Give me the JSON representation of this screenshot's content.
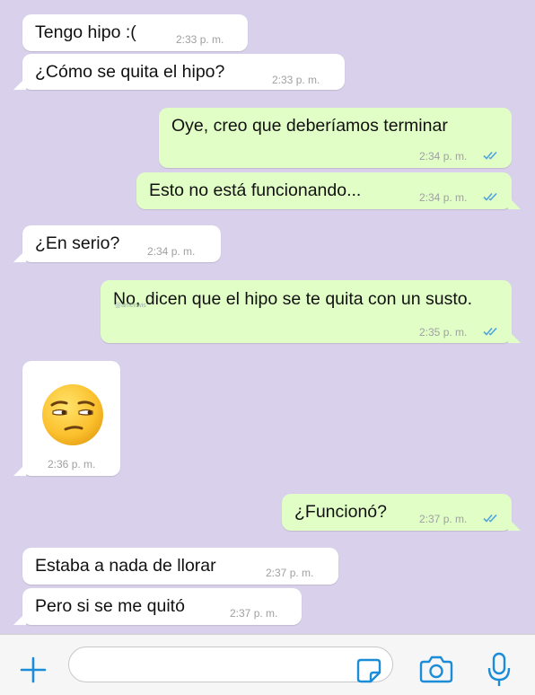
{
  "messages": [
    {
      "text": "Tengo hipo :(",
      "time": "2:33 p. m."
    },
    {
      "text": "¿Cómo se quita el hipo?",
      "time": "2:33 p. m."
    },
    {
      "text": "Oye, creo que deberíamos terminar",
      "time": "2:34 p. m."
    },
    {
      "text": "Esto no está funcionando...",
      "time": "2:34 p. m."
    },
    {
      "text": "¿En serio?",
      "time": "2:34 p. m."
    },
    {
      "text": "No, dicen que el hipo se te quita con un susto.",
      "time": "2:35 p. m.",
      "watermark": "@amenwis"
    },
    {
      "emoji": "😒",
      "time": "2:36 p. m."
    },
    {
      "text": "¿Funcionó?",
      "time": "2:37 p. m."
    },
    {
      "text": "Estaba a nada de llorar",
      "time": "2:37 p. m."
    },
    {
      "text": "Pero si se me quitó",
      "time": "2:37 p. m."
    }
  ],
  "input": {
    "placeholder": "",
    "value": ""
  },
  "colors": {
    "background": "#d9d1eb",
    "incoming": "#ffffff",
    "outgoing": "#e1fec6",
    "accent": "#1a8cd8",
    "read_ticks": "#4fa3e0"
  },
  "icons": [
    "plus-icon",
    "sticker-icon",
    "camera-icon",
    "microphone-icon",
    "double-check-icon"
  ]
}
